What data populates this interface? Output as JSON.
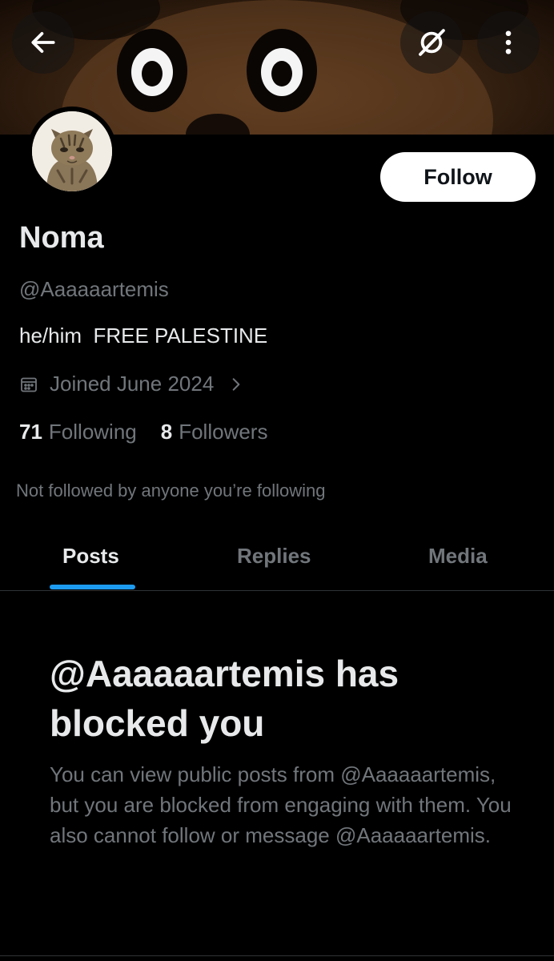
{
  "header": {
    "back_icon": "arrow-left-icon",
    "grok_icon": "grok-icon",
    "more_icon": "more-vertical-icon"
  },
  "profile": {
    "display_name": "Noma",
    "handle": "@Aaaaaartemis",
    "bio": "he/him  FREE PALESTINE",
    "joined": "Joined June 2024",
    "follow_label": "Follow",
    "following_count": "71",
    "following_label": "Following",
    "followers_count": "8",
    "followers_label": "Followers",
    "not_followed_text": "Not followed by anyone you’re following"
  },
  "tabs": [
    {
      "label": "Posts",
      "active": true
    },
    {
      "label": "Replies",
      "active": false
    },
    {
      "label": "Media",
      "active": false
    }
  ],
  "blocked": {
    "title": "@Aaaaaartemis has blocked you",
    "body": "You can view public posts from @Aaaaaartemis, but you are blocked from engaging with them. You also cannot follow or message @Aaaaaartemis."
  },
  "colors": {
    "background": "#000000",
    "text_primary": "#e7e9ea",
    "text_secondary": "#71767b",
    "accent": "#1d9bf0",
    "divider": "#2f3336"
  }
}
